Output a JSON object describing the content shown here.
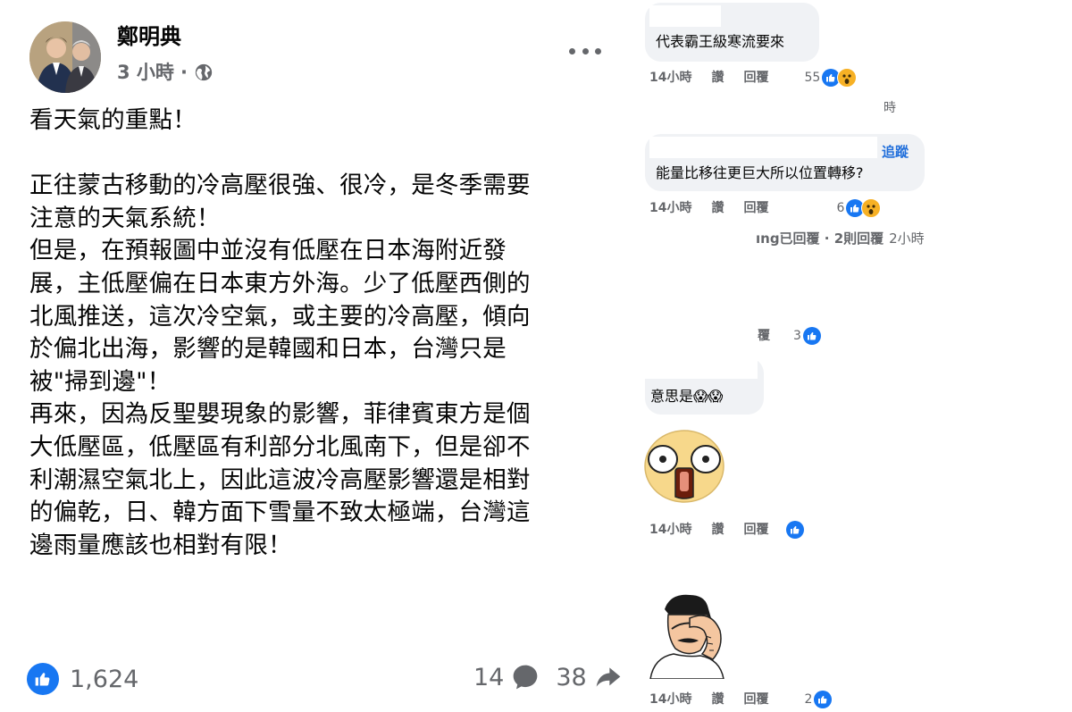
{
  "post": {
    "author": "鄭明典",
    "time": "3 小時",
    "lines": [
      "看天氣的重點！",
      "",
      "正往蒙古移動的冷高壓很強、很冷，是冬季需要",
      "注意的天氣系統！",
      "但是，在預報圖中並沒有低壓在日本海附近發",
      "展，主低壓偏在日本東方外海。少了低壓西側的",
      "北風推送，這次冷空氣，或主要的冷高壓，傾向",
      "於偏北出海，影響的是韓國和日本，台灣只是",
      "被\"掃到邊\"！",
      "再來，因為反聖嬰現象的影響，菲律賓東方是個",
      "大低壓區，低壓區有利部分北風南下，但是卻不",
      "利潮濕空氣北上，因此這波冷高壓影響還是相對",
      "的偏乾，日、韓方面下雪量不致太極端，台灣這",
      "邊雨量應該也相對有限！"
    ],
    "reactions": "1,624",
    "comments": "14",
    "shares": "38"
  },
  "comments": {
    "c1": {
      "text": "代表霸王級寒流要來",
      "time": "14小時",
      "like": "讚",
      "reply": "回覆",
      "count": "55"
    },
    "c1_sub": "時",
    "c2": {
      "follow": "追蹤",
      "text": "能量比移往更巨大所以位置轉移?",
      "time": "14小時",
      "like": "讚",
      "reply": "回覆",
      "count": "6"
    },
    "c2_replies": "ıng已回覆 · 2則回覆",
    "c2_replies_time": "2小時",
    "c3": {
      "reply": "覆",
      "count": "3"
    },
    "c4": {
      "text": "意思是😱😱"
    },
    "c5": {
      "time": "14小時",
      "like": "讚",
      "reply": "回覆"
    },
    "c6": {
      "time": "14小時",
      "like": "讚",
      "reply": "回覆",
      "count": "2"
    }
  },
  "icons": {
    "globe": "globe-icon",
    "more": "more-icon",
    "like": "like-icon",
    "comment": "comment-icon",
    "share": "share-icon",
    "wow": "wow-icon"
  },
  "colors": {
    "like_blue": "#1877f2",
    "wow_yellow": "#f7b125",
    "meta_gray": "#65676b",
    "bubble": "#f0f2f5"
  }
}
